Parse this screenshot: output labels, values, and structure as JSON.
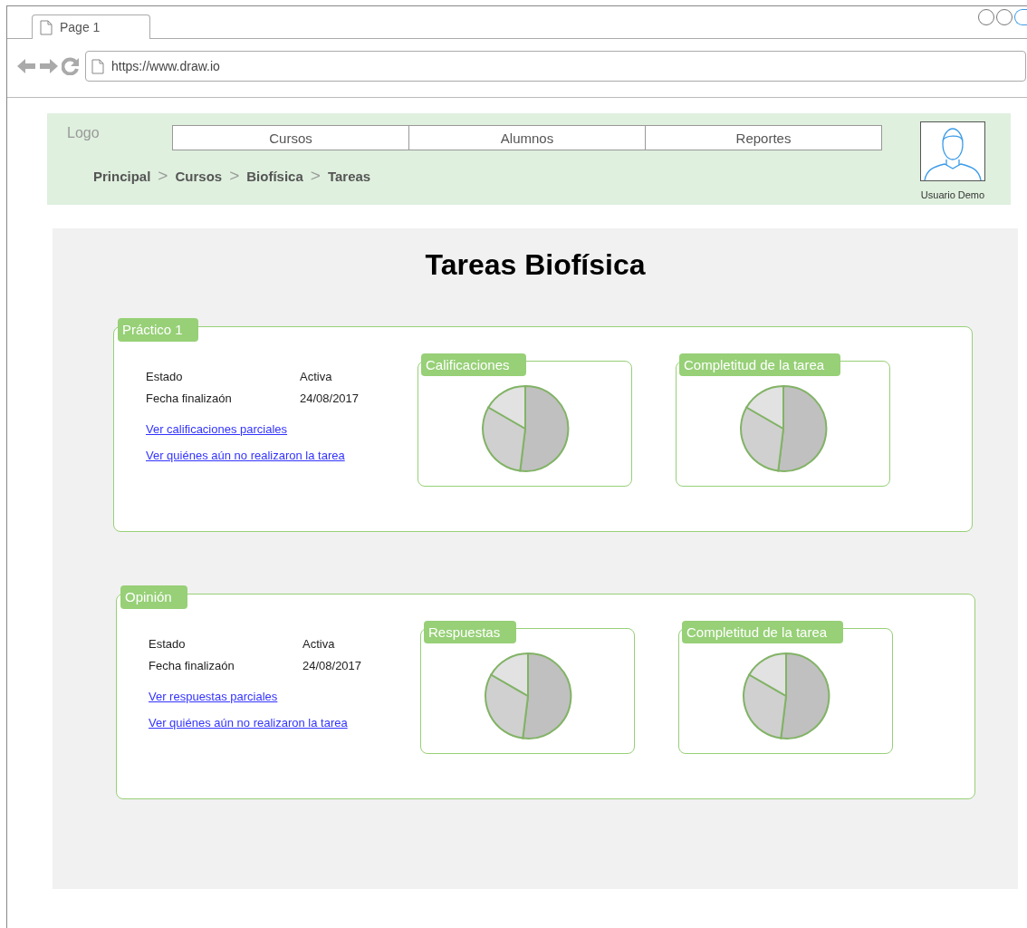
{
  "browser": {
    "tab": "Page 1",
    "url": "https://www.draw.io"
  },
  "header": {
    "logo": "Logo",
    "nav": [
      "Cursos",
      "Alumnos",
      "Reportes"
    ],
    "breadcrumb": [
      {
        "text": "Principal",
        "sep": ">"
      },
      {
        "text": "Cursos",
        "sep": ">"
      },
      {
        "text": "Biofísica",
        "sep": ">"
      },
      {
        "text": "Tareas"
      }
    ],
    "user": "Usuario Demo"
  },
  "title": "Tareas Biofísica",
  "tasks": [
    {
      "label": "Práctico 1",
      "fields": [
        {
          "name": "Estado",
          "value": "Activa"
        },
        {
          "name": "Fecha finalizaón",
          "value": "24/08/2017"
        }
      ],
      "links": [
        "Ver calificaciones parciales",
        "Ver quiénes aún no realizaron la tarea"
      ],
      "charts": [
        {
          "title": "Calificaciones"
        },
        {
          "title": "Completitud de la tarea"
        }
      ]
    },
    {
      "label": "Opinión",
      "fields": [
        {
          "name": "Estado",
          "value": "Activa"
        },
        {
          "name": "Fecha finalizaón",
          "value": "24/08/2017"
        }
      ],
      "links": [
        "Ver respuestas parciales",
        "Ver quiénes aún no realizaron la tarea"
      ],
      "charts": [
        {
          "title": "Respuestas"
        },
        {
          "title": "Completitud de la tarea"
        }
      ]
    }
  ]
}
